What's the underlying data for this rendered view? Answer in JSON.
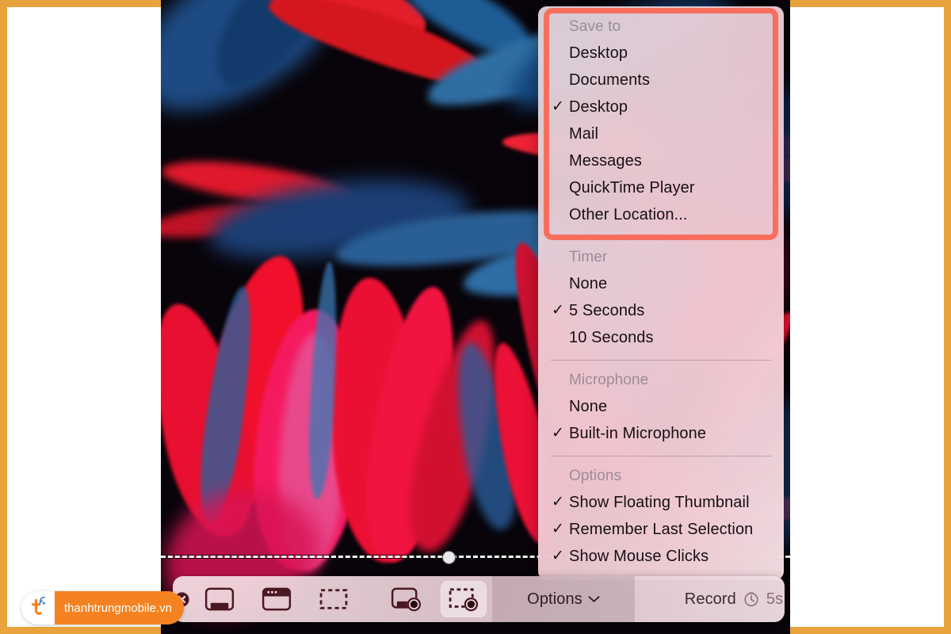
{
  "frame": {
    "accent_color": "#e8a33d",
    "background": "#ffffff"
  },
  "screenshot": {
    "wallpaper_description": "red and blue agave leaves on black background",
    "selection": {
      "handle": "selection-drag-handle"
    }
  },
  "options_menu": {
    "highlight_color": "#f86e5c",
    "sections": [
      {
        "header": "Save to",
        "items": [
          {
            "label": "Desktop",
            "checked": false
          },
          {
            "label": "Documents",
            "checked": false
          },
          {
            "label": "Desktop",
            "checked": true
          },
          {
            "label": "Mail",
            "checked": false
          },
          {
            "label": "Messages",
            "checked": false
          },
          {
            "label": "QuickTime Player",
            "checked": false
          },
          {
            "label": "Other Location...",
            "checked": false
          }
        ]
      },
      {
        "header": "Timer",
        "items": [
          {
            "label": "None",
            "checked": false
          },
          {
            "label": "5 Seconds",
            "checked": true
          },
          {
            "label": "10 Seconds",
            "checked": false
          }
        ]
      },
      {
        "header": "Microphone",
        "items": [
          {
            "label": "None",
            "checked": false
          },
          {
            "label": "Built-in Microphone",
            "checked": true
          }
        ]
      },
      {
        "header": "Options",
        "items": [
          {
            "label": "Show Floating Thumbnail",
            "checked": true
          },
          {
            "label": "Remember Last Selection",
            "checked": true
          },
          {
            "label": "Show Mouse Clicks",
            "checked": true
          }
        ]
      }
    ],
    "check_glyph": "✓"
  },
  "toolbar": {
    "close_icon": "close-circle-icon",
    "buttons": [
      {
        "name": "capture-entire-screen",
        "icon": "display-icon",
        "active": false
      },
      {
        "name": "capture-selected-window",
        "icon": "window-icon",
        "active": false
      },
      {
        "name": "capture-selected-portion",
        "icon": "dashed-rectangle-icon",
        "active": false
      },
      {
        "name": "record-entire-screen",
        "icon": "display-record-icon",
        "active": false
      },
      {
        "name": "record-selected-portion",
        "icon": "dashed-record-icon",
        "active": true
      }
    ],
    "options_label": "Options",
    "options_chevron": "⌄",
    "record_label": "Record",
    "record_timer_icon": "timer-icon",
    "record_timer_value": "5s"
  },
  "watermark": {
    "text": "thanhtrungmobile.vn",
    "logo_letter": "t",
    "badge_color": "#f58220"
  }
}
